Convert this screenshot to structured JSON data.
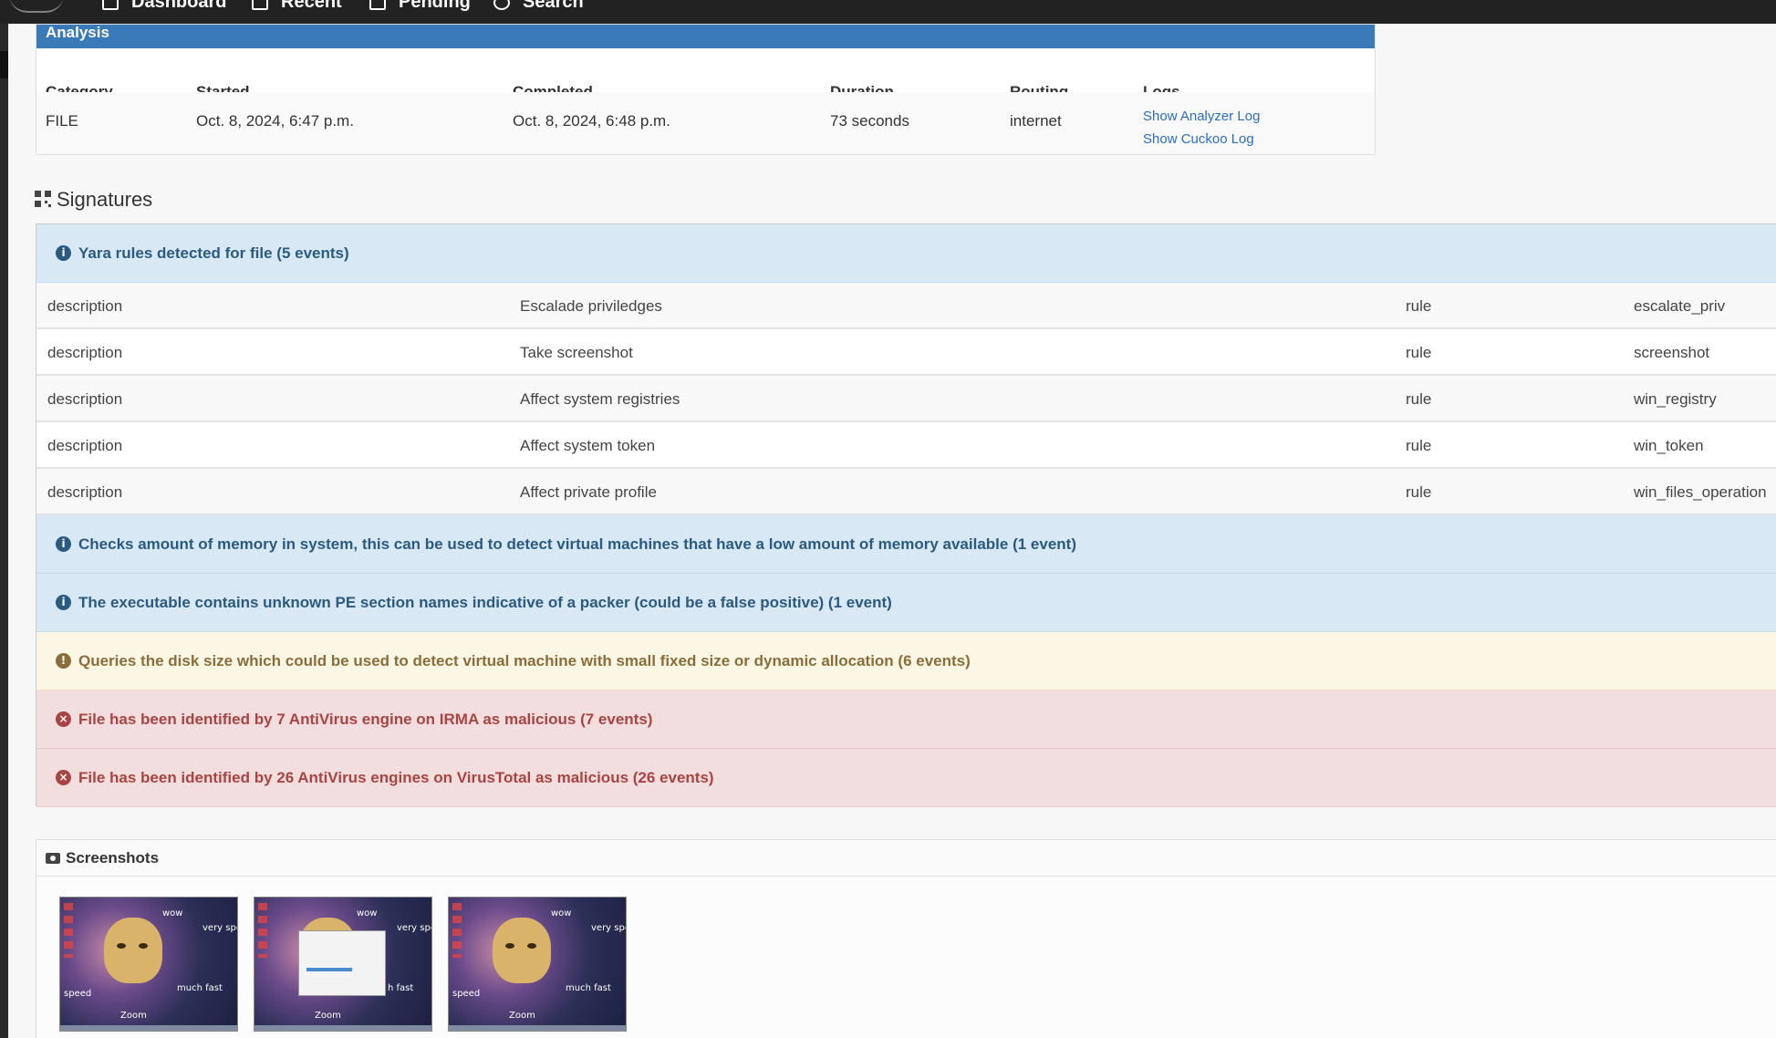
{
  "nav": {
    "items": [
      {
        "label": "Dashboard",
        "icon": "home-icon"
      },
      {
        "label": "Recent",
        "icon": "list-icon"
      },
      {
        "label": "Pending",
        "icon": "cogs-icon"
      },
      {
        "label": "Search",
        "icon": "search-icon"
      }
    ]
  },
  "analysis": {
    "title": "Analysis",
    "headers": [
      "Category",
      "Started",
      "Completed",
      "Duration",
      "Routing",
      "Logs"
    ],
    "row": {
      "category": "FILE",
      "started": "Oct. 8, 2024, 6:47 p.m.",
      "completed": "Oct. 8, 2024, 6:48 p.m.",
      "duration": "73 seconds",
      "routing": "internet",
      "logs": [
        "Show Analyzer Log",
        "Show Cuckoo Log"
      ]
    }
  },
  "signatures": {
    "title": "Signatures",
    "yara_alert": "Yara rules detected for file (5 events)",
    "yara_rows": [
      {
        "k1": "description",
        "v1": "Escalade priviledges",
        "k2": "rule",
        "v2": "escalate_priv"
      },
      {
        "k1": "description",
        "v1": "Take screenshot",
        "k2": "rule",
        "v2": "screenshot"
      },
      {
        "k1": "description",
        "v1": "Affect system registries",
        "k2": "rule",
        "v2": "win_registry"
      },
      {
        "k1": "description",
        "v1": "Affect system token",
        "k2": "rule",
        "v2": "win_token"
      },
      {
        "k1": "description",
        "v1": "Affect private profile",
        "k2": "rule",
        "v2": "win_files_operation"
      }
    ],
    "alerts": [
      {
        "level": "info",
        "text": "Checks amount of memory in system, this can be used to detect virtual machines that have a low amount of memory available (1 event)"
      },
      {
        "level": "info",
        "text": "The executable contains unknown PE section names indicative of a packer (could be a false positive) (1 event)"
      },
      {
        "level": "warning",
        "text": "Queries the disk size which could be used to detect virtual machine with small fixed size or dynamic allocation (6 events)"
      },
      {
        "level": "danger",
        "text": "File has been identified by 7 AntiVirus engine on IRMA as malicious (7 events)"
      },
      {
        "level": "danger",
        "text": "File has been identified by 26 AntiVirus engines on VirusTotal as malicious (26 events)"
      }
    ]
  },
  "screenshots": {
    "title": "Screenshots",
    "thumbs": [
      {
        "t1": "wow",
        "t2": "very spe",
        "t3": "much fast",
        "t4": "Zoom",
        "t5": "speed",
        "dialog": false
      },
      {
        "t1": "wow",
        "t2": "very spe",
        "t3": "h fast",
        "t4": "Zoom",
        "t5": "",
        "dialog": true
      },
      {
        "t1": "wow",
        "t2": "very spe",
        "t3": "much fast",
        "t4": "Zoom",
        "t5": "speed",
        "dialog": false
      }
    ]
  },
  "colors": {
    "header_blue": "#3a7ab9",
    "info_bg": "#d9e8f5",
    "warning_bg": "#fcf7e4",
    "danger_bg": "#f2dede",
    "link": "#2a6ebd"
  }
}
